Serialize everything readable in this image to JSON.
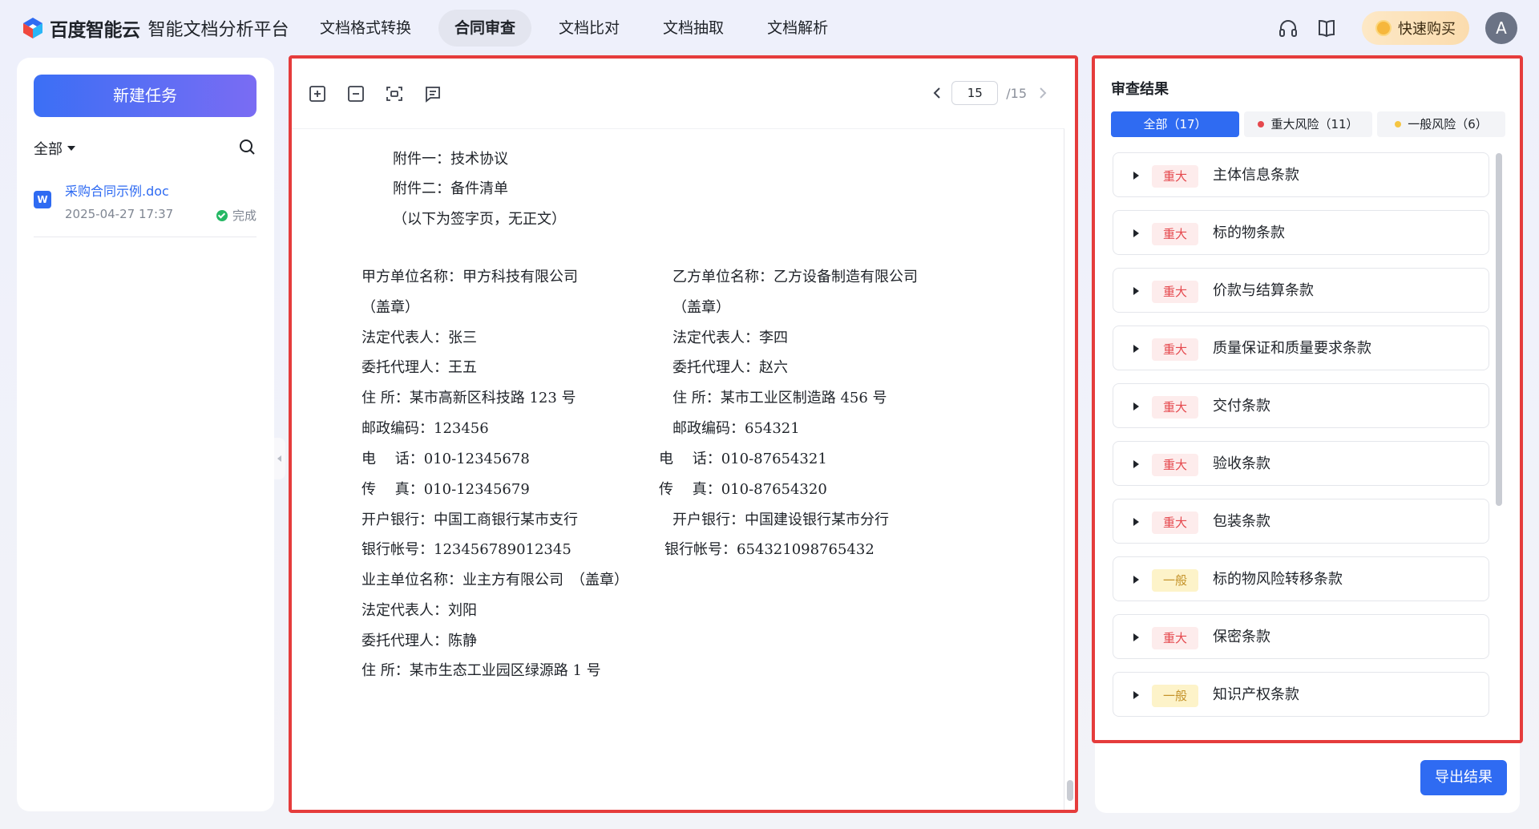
{
  "header": {
    "brand": "百度智能云",
    "product": "智能文档分析平台",
    "nav": [
      "文档格式转换",
      "合同审查",
      "文档比对",
      "文档抽取",
      "文档解析"
    ],
    "active_nav": 1,
    "buy_label": "快速购买",
    "avatar_letter": "A",
    "icons": [
      "headset-icon",
      "book-icon",
      "coin-icon"
    ]
  },
  "sidebar": {
    "new_task_label": "新建任务",
    "filter_label": "全部",
    "files": [
      {
        "name": "采购合同示例.doc",
        "date": "2025-04-27 17:37",
        "status": "完成"
      }
    ]
  },
  "viewer": {
    "current_page": "15",
    "total_pages": "/15",
    "tools": [
      "zoom-in-icon",
      "zoom-out-icon",
      "fit-screen-icon",
      "comment-icon"
    ],
    "lines": {
      "att1": "附件一：技术协议",
      "att2": "附件二：备件清单",
      "sign_note": "（以下为签字页，无正文）",
      "a_name": "甲方单位名称：甲方科技有限公司",
      "b_name": "乙方单位名称：乙方设备制造有限公司",
      "a_seal": "（盖章）",
      "b_seal": "（盖章）",
      "a_rep": "法定代表人：张三",
      "b_rep": "法定代表人：李四",
      "a_agent": "委托代理人：王五",
      "b_agent": "委托代理人：赵六",
      "a_addr": "住 所：某市高新区科技路 123 号",
      "b_addr": "住 所：某市工业区制造路 456 号",
      "a_zip": "邮政编码：123456",
      "b_zip": "邮政编码：654321",
      "a_tel": "电　 话：010-12345678",
      "b_tel": "电　 话：010-87654321",
      "a_fax": "传　 真：010-12345679",
      "b_fax": "传　 真：010-87654320",
      "a_bank": "开户银行：中国工商银行某市支行",
      "b_bank": "开户银行：中国建设银行某市分行",
      "a_acct": "银行帐号：123456789012345",
      "b_acct": "银行帐号：654321098765432",
      "c_name": "业主单位名称：业主方有限公司　（盖章）",
      "c_rep": "法定代表人：刘阳",
      "c_agent": "委托代理人：陈静",
      "c_addr": "住 所：某市生态工业园区绿源路 1 号"
    }
  },
  "results": {
    "title": "审查结果",
    "tabs": [
      {
        "label": "全部（17）",
        "dot": ""
      },
      {
        "label": "重大风险（11）",
        "dot": "#e5484d"
      },
      {
        "label": "一般风险（6）",
        "dot": "#f5c542"
      }
    ],
    "items": [
      {
        "level": "重大",
        "type": "major",
        "label": "主体信息条款"
      },
      {
        "level": "重大",
        "type": "major",
        "label": "标的物条款"
      },
      {
        "level": "重大",
        "type": "major",
        "label": "价款与结算条款"
      },
      {
        "level": "重大",
        "type": "major",
        "label": "质量保证和质量要求条款"
      },
      {
        "level": "重大",
        "type": "major",
        "label": "交付条款"
      },
      {
        "level": "重大",
        "type": "major",
        "label": "验收条款"
      },
      {
        "level": "重大",
        "type": "major",
        "label": "包装条款"
      },
      {
        "level": "一般",
        "type": "general",
        "label": "标的物风险转移条款"
      },
      {
        "level": "重大",
        "type": "major",
        "label": "保密条款"
      },
      {
        "level": "一般",
        "type": "general",
        "label": "知识产权条款"
      }
    ],
    "export_label": "导出结果"
  }
}
